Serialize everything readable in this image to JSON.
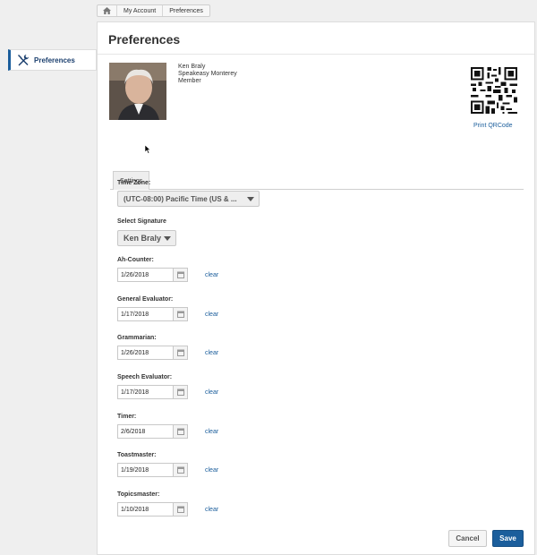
{
  "breadcrumb": {
    "home_icon": "home-icon",
    "items": [
      "My Account",
      "Preferences"
    ]
  },
  "sidebar": {
    "item_label": "Preferences",
    "item_icon": "tools-icon"
  },
  "page": {
    "title": "Preferences"
  },
  "profile": {
    "name": "Ken Braly",
    "club": "Speakeasy Monterey",
    "role": "Member",
    "qr_link": "Print QRCode"
  },
  "tabs": [
    "Settings"
  ],
  "form": {
    "timezone": {
      "label": "Time Zone:",
      "value": "(UTC-08:00) Pacific Time (US & ..."
    },
    "signature": {
      "label": "Select Signature",
      "value": "Ken Braly"
    },
    "clear_label": "clear",
    "roles": [
      {
        "label": "Ah-Counter:",
        "date": "1/26/2018"
      },
      {
        "label": "General Evaluator:",
        "date": "1/17/2018"
      },
      {
        "label": "Grammarian:",
        "date": "1/26/2018"
      },
      {
        "label": "Speech Evaluator:",
        "date": "1/17/2018"
      },
      {
        "label": "Timer:",
        "date": "2/6/2018"
      },
      {
        "label": "Toastmaster:",
        "date": "1/19/2018"
      },
      {
        "label": "Topicsmaster:",
        "date": "1/10/2018"
      }
    ]
  },
  "actions": {
    "cancel": "Cancel",
    "save": "Save"
  },
  "colors": {
    "accent": "#1b5e9c",
    "background": "#efefef"
  }
}
